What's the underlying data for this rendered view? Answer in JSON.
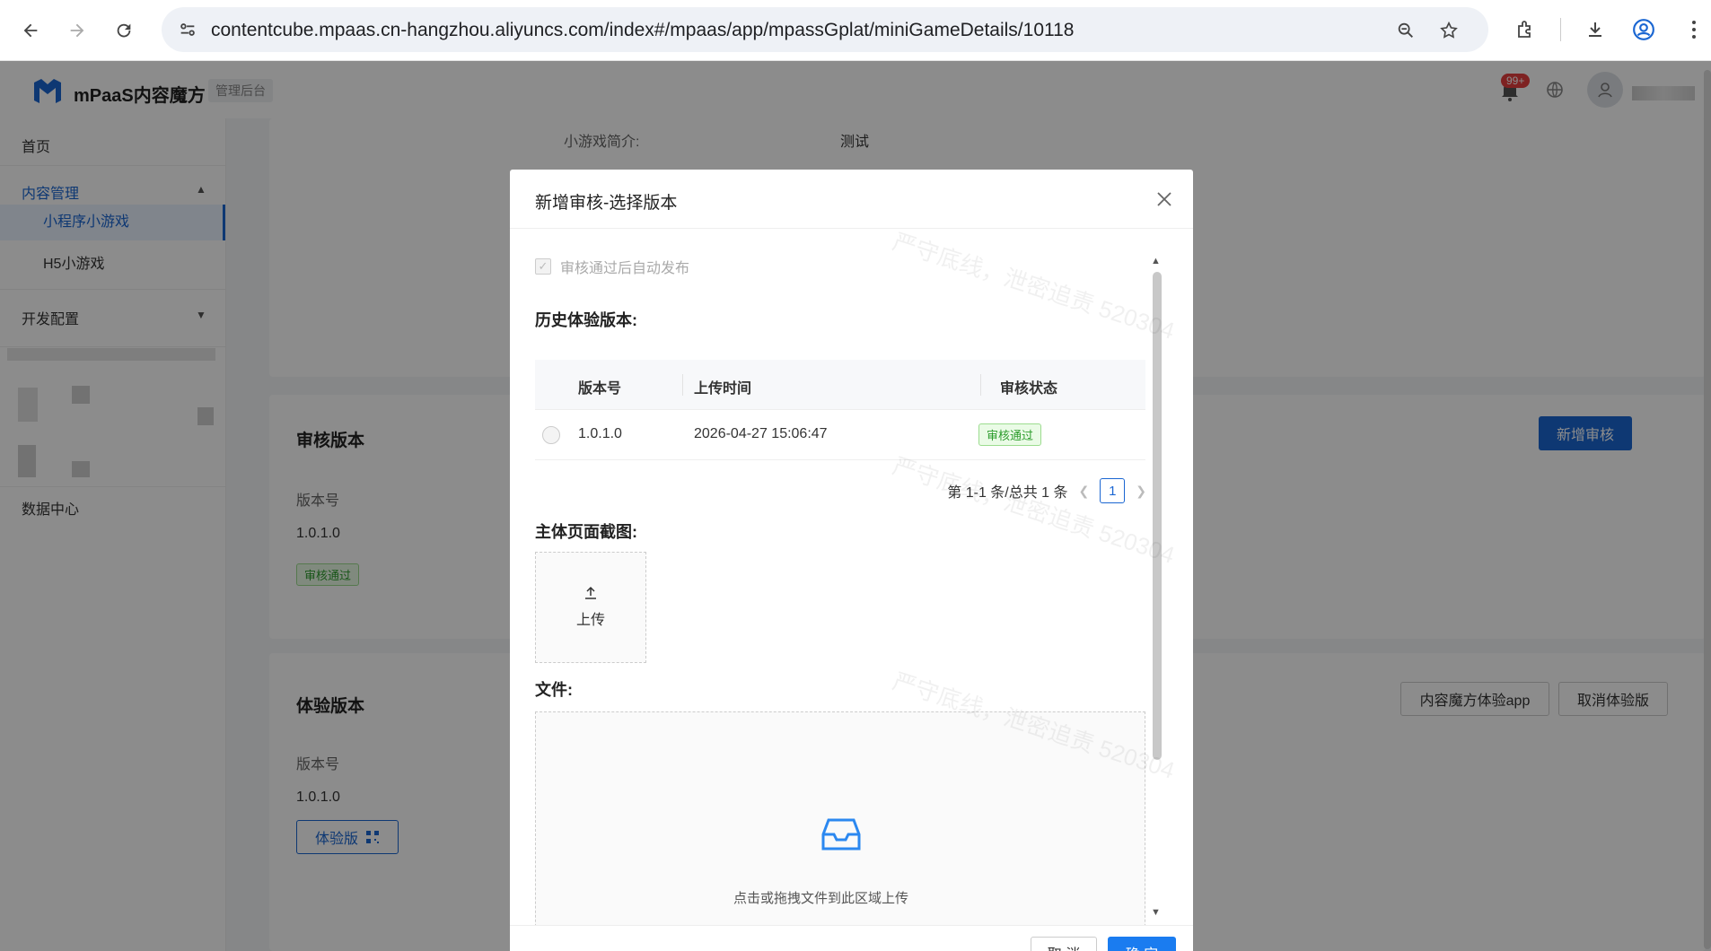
{
  "browser": {
    "url": "contentcube.mpaas.cn-hangzhou.aliyuncs.com/index#/mpaas/app/mpassGplat/miniGameDetails/10118"
  },
  "header": {
    "app_name": "mPaaS内容魔方",
    "badge": "管理后台",
    "notification_count": "99+"
  },
  "sidebar": {
    "home": "首页",
    "content_mgmt": "内容管理",
    "mini_game": "小程序小游戏",
    "h5_game": "H5小游戏",
    "dev_config": "开发配置",
    "data_center": "数据中心"
  },
  "main": {
    "intro_label": "小游戏简介:",
    "intro_value": "测试",
    "review_card": {
      "title": "审核版本",
      "version_label": "版本号",
      "version_value": "1.0.1.0",
      "status": "审核通过",
      "add_review": "新增审核"
    },
    "trial_card": {
      "title": "体验版本",
      "version_label": "版本号",
      "version_value": "1.0.1.0",
      "trial_button": "体验版",
      "app_button": "内容魔方体验app",
      "cancel_button": "取消体验版"
    }
  },
  "modal": {
    "title": "新增审核-选择版本",
    "auto_publish": "审核通过后自动发布",
    "history_title": "历史体验版本:",
    "columns": [
      "版本号",
      "上传时间",
      "审核状态"
    ],
    "rows": [
      {
        "version": "1.0.1.0",
        "time": "2026-04-27 15:06:47",
        "status": "审核通过"
      }
    ],
    "pagination_text": "第 1-1 条/总共 1 条",
    "current_page": "1",
    "screenshot_title": "主体页面截图:",
    "upload_label": "上传",
    "file_title": "文件:",
    "drop_text": "点击或拖拽文件到此区域上传",
    "cancel": "取 消",
    "ok": "确 定"
  },
  "colors": {
    "primary": "#1a66d2",
    "success": "#2c9c2c",
    "overlay": "rgba(0,0,0,0.45)"
  },
  "watermark": "严守底线，泄密追责 520304"
}
